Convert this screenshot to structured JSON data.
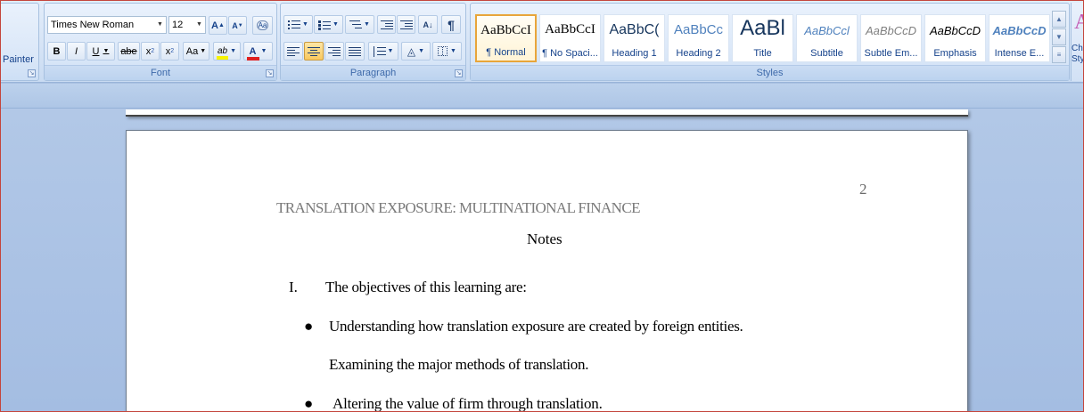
{
  "clipboard": {
    "painter_label": "Painter"
  },
  "font_group": {
    "label": "Font",
    "font_name": "Times New Roman",
    "font_size": "12",
    "grow_label": "A",
    "shrink_label": "A",
    "clear_label": "Aa",
    "bold_label": "B",
    "italic_label": "I",
    "underline_label": "U",
    "strike_label": "abe",
    "subscript_label": "x",
    "superscript_label": "x",
    "case_label": "Aa",
    "highlight_label": "ab",
    "font_color_label": "A",
    "highlight_color": "#f7f300",
    "font_color": "#e0201f"
  },
  "paragraph_group": {
    "label": "Paragraph"
  },
  "styles_group": {
    "label": "Styles",
    "tiles": [
      {
        "sample": "AaBbCcI",
        "name": "¶ Normal",
        "selected": true
      },
      {
        "sample": "AaBbCcI",
        "name": "¶ No Spaci..."
      },
      {
        "sample": "AaBbC(",
        "name": "Heading 1"
      },
      {
        "sample": "AaBbCc",
        "name": "Heading 2"
      },
      {
        "sample": "AaBl",
        "name": "Title"
      },
      {
        "sample": "AaBbCcl",
        "name": "Subtitle"
      },
      {
        "sample": "AaBbCcD",
        "name": "Subtle Em..."
      },
      {
        "sample": "AaBbCcD",
        "name": "Emphasis"
      },
      {
        "sample": "AaBbCcD",
        "name": "Intense E..."
      }
    ],
    "change_styles_label": "Ch",
    "change_styles_label2": "Sty"
  },
  "document": {
    "page_number": "2",
    "running_head": "TRANSLATION EXPOSURE: MULTINATIONAL FINANCE",
    "title": "Notes",
    "list_marker": "I.",
    "list_heading": "The objectives of this learning are:",
    "bullets": [
      "Understanding how translation exposure are created by foreign entities.",
      "Examining the major methods of translation.",
      "Altering the value of firm through translation."
    ]
  },
  "colors": {
    "ribbon_bg": "#dae7f8",
    "workspace_bg": "#a9c1e1",
    "selected_style_border": "#e8a53a",
    "window_border": "#c4453c"
  }
}
